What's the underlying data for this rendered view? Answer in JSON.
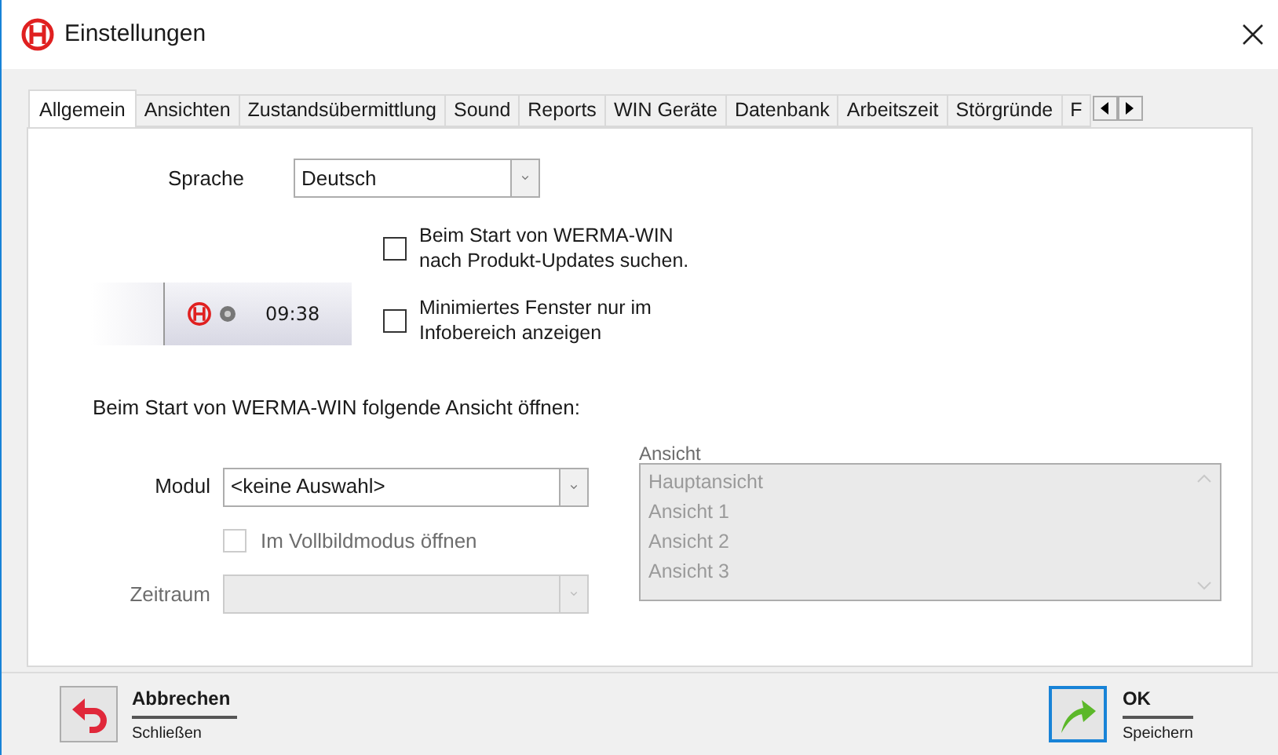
{
  "window": {
    "title": "Einstellungen"
  },
  "tabs": [
    {
      "label": "Allgemein",
      "selected": true
    },
    {
      "label": "Ansichten",
      "selected": false
    },
    {
      "label": "Zustandsübermittlung",
      "selected": false
    },
    {
      "label": "Sound",
      "selected": false
    },
    {
      "label": "Reports",
      "selected": false
    },
    {
      "label": "WIN Geräte",
      "selected": false
    },
    {
      "label": "Datenbank",
      "selected": false
    },
    {
      "label": "Arbeitszeit",
      "selected": false
    },
    {
      "label": "Störgründe",
      "selected": false
    },
    {
      "label": "F",
      "selected": false
    }
  ],
  "language": {
    "label": "Sprache",
    "value": "Deutsch"
  },
  "options": [
    {
      "label": "Beim Start von WERMA-WIN nach Produkt-Updates suchen.",
      "checked": false
    },
    {
      "label": "Minimiertes Fenster nur im Infobereich anzeigen",
      "checked": false
    }
  ],
  "tray_preview": {
    "time": "09:38"
  },
  "startup": {
    "heading": "Beim Start von WERMA-WIN folgende Ansicht öffnen:",
    "module": {
      "label": "Modul",
      "value": "<keine Auswahl>"
    },
    "fullscreen": {
      "label": "Im Vollbildmodus öffnen",
      "checked": false,
      "disabled": true
    },
    "period": {
      "label": "Zeitraum",
      "disabled": true
    },
    "views": {
      "label": "Ansicht",
      "disabled": true,
      "items": [
        "Hauptansicht",
        "Ansicht 1",
        "Ansicht 2",
        "Ansicht 3"
      ]
    }
  },
  "footer": {
    "cancel": {
      "label": "Abbrechen",
      "sublabel": "Schließen"
    },
    "ok": {
      "label": "OK",
      "sublabel": "Speichern"
    }
  }
}
